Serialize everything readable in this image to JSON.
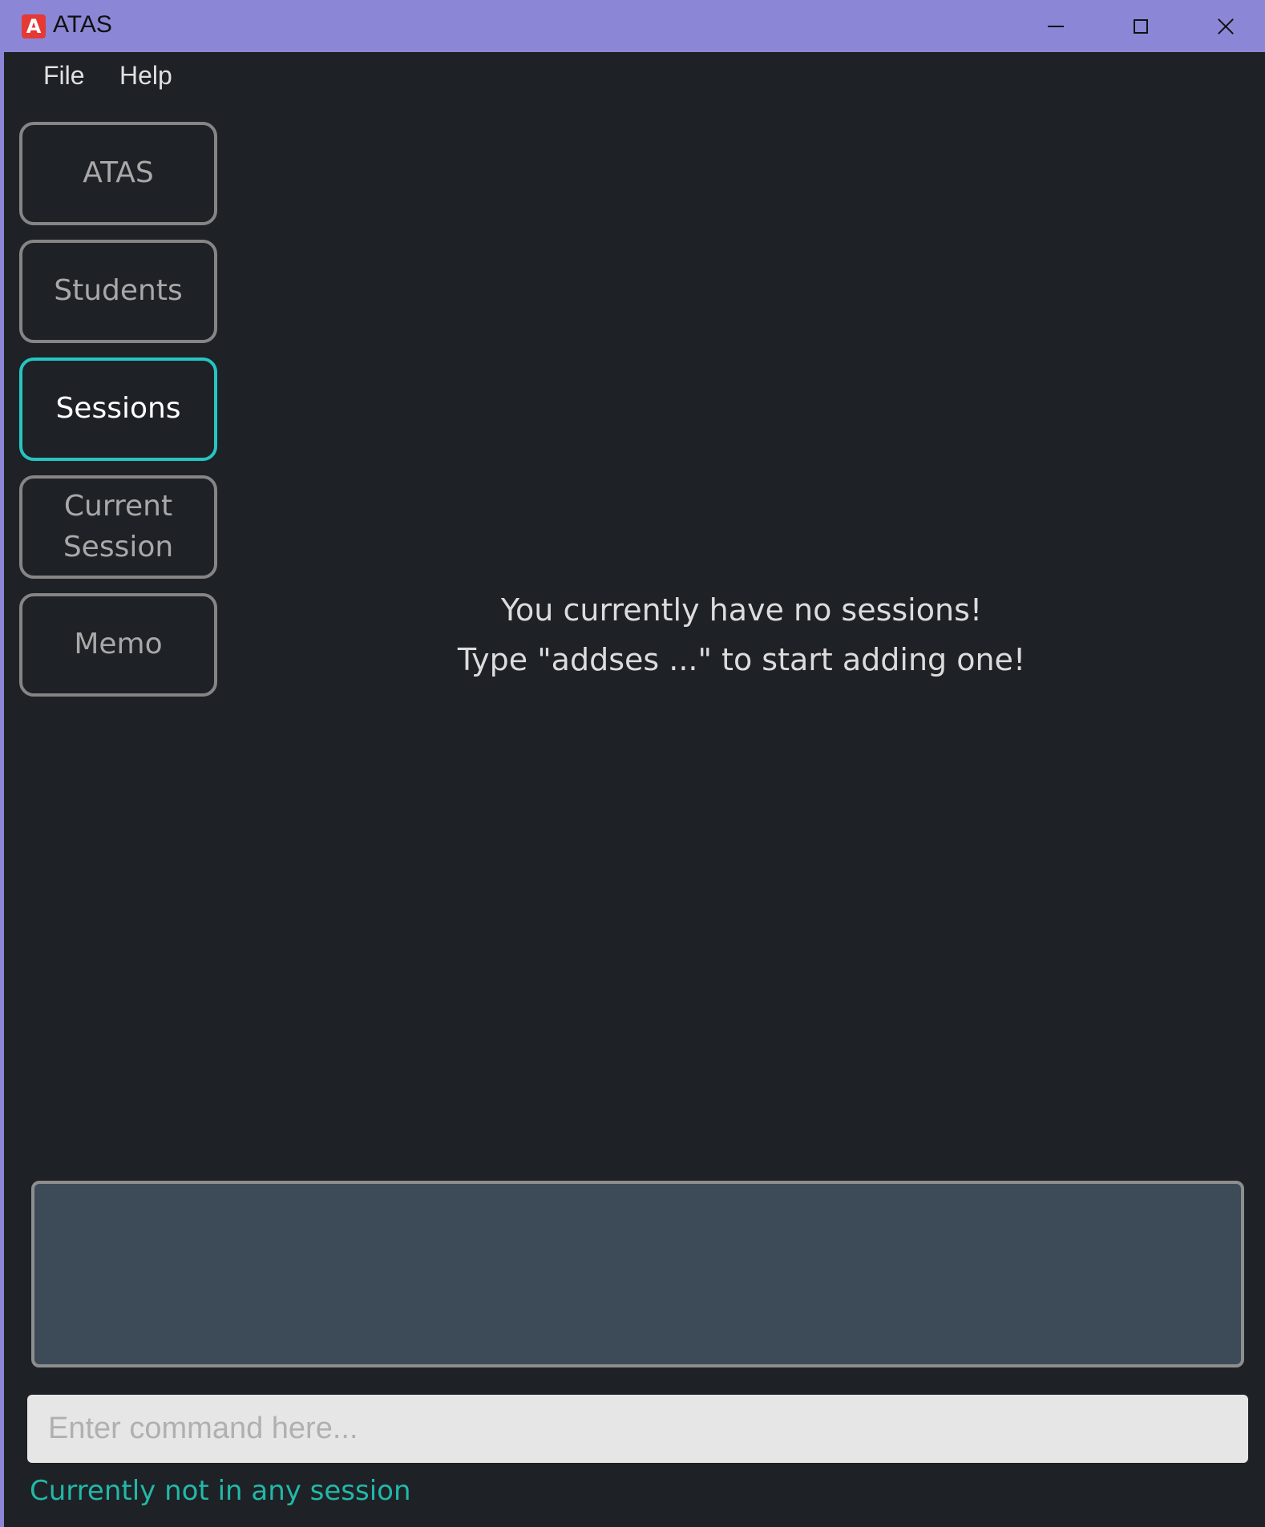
{
  "window": {
    "title": "ATAS",
    "logo_letter": "A",
    "controls": {
      "minimize": "minimize-icon",
      "maximize": "maximize-icon",
      "close": "close-icon"
    }
  },
  "menu": {
    "file": "File",
    "help": "Help"
  },
  "nav": {
    "atas": "ATAS",
    "students": "Students",
    "sessions": "Sessions",
    "current_session": "Current Session",
    "memo": "Memo",
    "active": "sessions"
  },
  "main": {
    "empty_line1": "You currently have no sessions!",
    "empty_line2": "Type \"addses ...\" to start adding one!"
  },
  "result": {
    "text": ""
  },
  "command": {
    "value": "",
    "placeholder": "Enter command here..."
  },
  "status": {
    "text": "Currently not in any session"
  },
  "colors": {
    "titlebar": "#8b87d6",
    "background": "#1e2126",
    "accent": "#26c6c0",
    "status": "#22b8a8",
    "result_box": "#3d4b58"
  }
}
